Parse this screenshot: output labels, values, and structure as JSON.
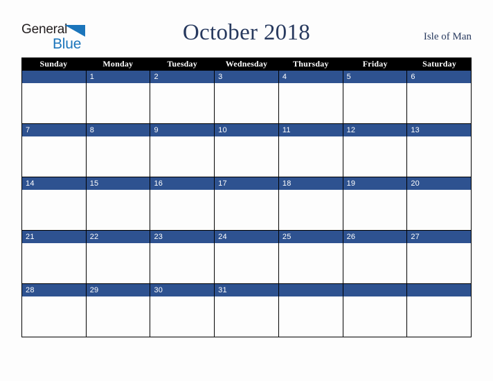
{
  "brand": {
    "name_top": "General",
    "name_bottom": "Blue",
    "color_dark": "#231f20",
    "color_blue": "#1b75bb"
  },
  "header": {
    "title": "October 2018",
    "location": "Isle of Man",
    "title_color": "#27395e"
  },
  "calendar": {
    "weekday_headers": [
      "Sunday",
      "Monday",
      "Tuesday",
      "Wednesday",
      "Thursday",
      "Friday",
      "Saturday"
    ],
    "header_bg": "#000000",
    "header_text": "#ffffff",
    "date_bar_bg": "#2e5290",
    "date_text": "#ffffff",
    "cell_bg": "#fdfdfd",
    "grid_line": "#000000",
    "weeks": [
      [
        "",
        "1",
        "2",
        "3",
        "4",
        "5",
        "6"
      ],
      [
        "7",
        "8",
        "9",
        "10",
        "11",
        "12",
        "13"
      ],
      [
        "14",
        "15",
        "16",
        "17",
        "18",
        "19",
        "20"
      ],
      [
        "21",
        "22",
        "23",
        "24",
        "25",
        "26",
        "27"
      ],
      [
        "28",
        "29",
        "30",
        "31",
        "",
        "",
        ""
      ]
    ]
  }
}
